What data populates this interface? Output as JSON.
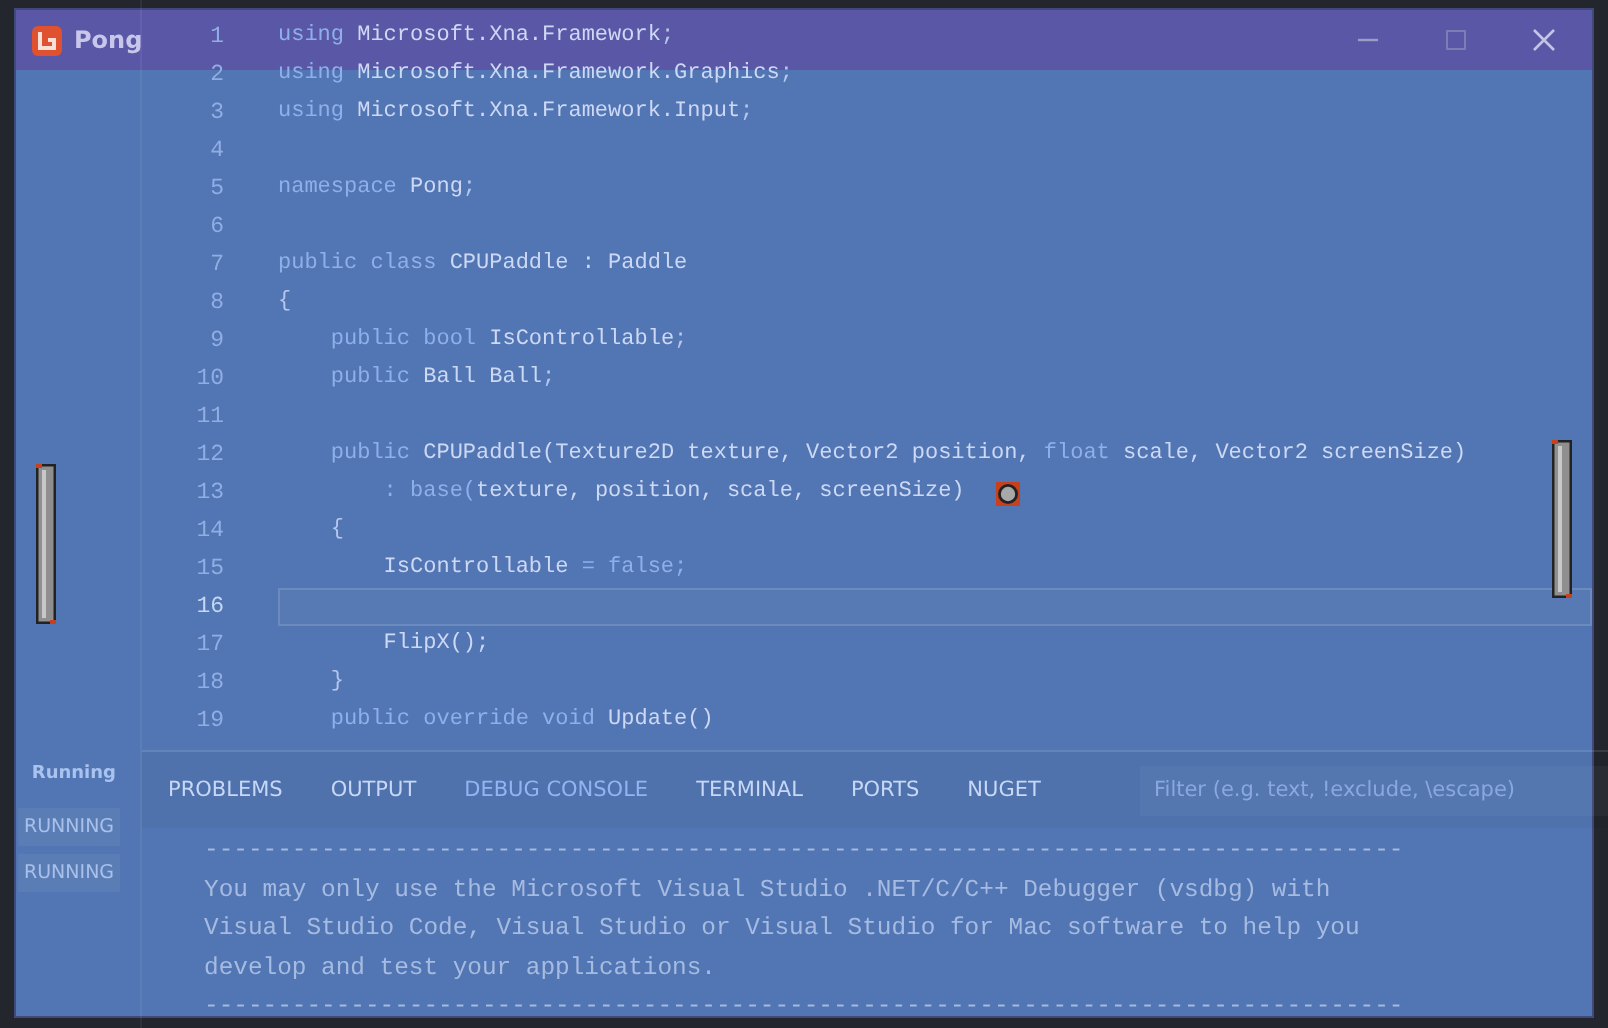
{
  "window": {
    "title": "Pong"
  },
  "editor": {
    "lines": [
      {
        "number": "1",
        "current": false,
        "tokens": [
          {
            "t": "using ",
            "kind": "kw"
          },
          {
            "t": "Microsoft.Xna.Framework",
            "kind": "name"
          },
          {
            "t": ";",
            "kind": "punc"
          }
        ]
      },
      {
        "number": "2",
        "current": false,
        "tokens": [
          {
            "t": "using ",
            "kind": "kw"
          },
          {
            "t": "Microsoft.Xna.Framework.Graphics",
            "kind": "name"
          },
          {
            "t": ";",
            "kind": "punc"
          }
        ]
      },
      {
        "number": "3",
        "current": false,
        "tokens": [
          {
            "t": "using ",
            "kind": "kw"
          },
          {
            "t": "Microsoft.Xna.Framework.Input",
            "kind": "name"
          },
          {
            "t": ";",
            "kind": "punc"
          }
        ]
      },
      {
        "number": "4",
        "current": false
      },
      {
        "number": "5",
        "current": false,
        "tokens": [
          {
            "t": "namespace ",
            "kind": "kw"
          },
          {
            "t": "Pong",
            "kind": "name"
          },
          {
            "t": ";",
            "kind": "punc"
          }
        ]
      },
      {
        "number": "6",
        "current": false
      },
      {
        "number": "7",
        "current": false,
        "tokens": [
          {
            "t": "public class ",
            "kind": "kw"
          },
          {
            "t": "CPUPaddle : Paddle",
            "kind": "name"
          }
        ]
      },
      {
        "number": "8",
        "current": false,
        "tokens": [
          {
            "t": "{",
            "kind": "punc"
          }
        ]
      },
      {
        "number": "9",
        "current": false,
        "tokens": [
          {
            "t": "    public bool ",
            "kind": "kw"
          },
          {
            "t": "IsControllable",
            "kind": "name"
          },
          {
            "t": ";",
            "kind": "punc"
          }
        ]
      },
      {
        "number": "10",
        "current": false,
        "tokens": [
          {
            "t": "    public ",
            "kind": "kw"
          },
          {
            "t": "Ball Ball",
            "kind": "name"
          },
          {
            "t": ";",
            "kind": "punc"
          }
        ]
      },
      {
        "number": "11",
        "current": false
      },
      {
        "number": "12",
        "current": false,
        "tokens": [
          {
            "t": "    public ",
            "kind": "kw"
          },
          {
            "t": "CPUPaddle(Texture2D texture, Vector2 position, ",
            "kind": "name"
          },
          {
            "t": "float ",
            "kind": "kw"
          },
          {
            "t": "scale, Vector2 screenSize)",
            "kind": "name"
          }
        ]
      },
      {
        "number": "13",
        "current": false,
        "tokens": [
          {
            "t": "        : base(",
            "kind": "kw"
          },
          {
            "t": "texture, position, scale, screenSize)",
            "kind": "name"
          }
        ]
      },
      {
        "number": "14",
        "current": false,
        "tokens": [
          {
            "t": "    {",
            "kind": "punc"
          }
        ]
      },
      {
        "number": "15",
        "current": false,
        "tokens": [
          {
            "t": "        IsControllable ",
            "kind": "name"
          },
          {
            "t": "= false;",
            "kind": "kw"
          }
        ]
      },
      {
        "number": "16",
        "current": true
      },
      {
        "number": "17",
        "current": false,
        "tokens": [
          {
            "t": "        FlipX();",
            "kind": "name"
          }
        ]
      },
      {
        "number": "18",
        "current": false,
        "tokens": [
          {
            "t": "    }",
            "kind": "punc"
          }
        ]
      },
      {
        "number": "19",
        "current": false,
        "tokens": [
          {
            "t": "    public override void ",
            "kind": "kw"
          },
          {
            "t": "Update()",
            "kind": "name"
          }
        ]
      }
    ]
  },
  "sidebar": {
    "section": "Running",
    "badges": [
      "RUNNING",
      "RUNNING"
    ]
  },
  "panel": {
    "tabs": [
      {
        "label": "PROBLEMS",
        "selected": false
      },
      {
        "label": "OUTPUT",
        "selected": false
      },
      {
        "label": "DEBUG CONSOLE",
        "selected": true
      },
      {
        "label": "TERMINAL",
        "selected": false
      },
      {
        "label": "PORTS",
        "selected": false
      },
      {
        "label": "NUGET",
        "selected": false
      }
    ],
    "filter": {
      "placeholder": "Filter (e.g. text, !exclude, \\escape)"
    },
    "output": [
      "----------------------------------------------------------------------------------",
      "You may only use the Microsoft Visual Studio .NET/C/C++ Debugger (vsdbg) with",
      "Visual Studio Code, Visual Studio or Visual Studio for Mac software to help you",
      "develop and test your applications.",
      "----------------------------------------------------------------------------------"
    ]
  }
}
